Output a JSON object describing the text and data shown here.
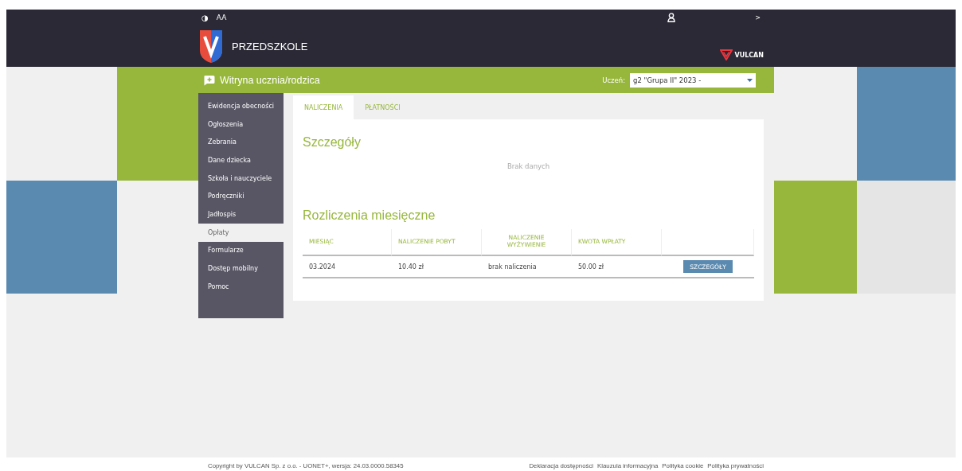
{
  "toolbar": {
    "contrast_label": "◑",
    "font_size_label": "AA",
    "user_arrow": ">"
  },
  "header": {
    "app_name": "PRZEDSZKOLE",
    "brand": "VULCAN"
  },
  "section_bar": {
    "title": "Witryna ucznia/rodzica",
    "student_label": "Uczeń:",
    "student_value": "g2 \"Grupa II\" 2023 -"
  },
  "sidebar": {
    "items": [
      {
        "label": "Ewidencja obecności",
        "selected": false
      },
      {
        "label": "Ogłoszenia",
        "selected": false
      },
      {
        "label": "Zebrania",
        "selected": false
      },
      {
        "label": "Dane dziecka",
        "selected": false
      },
      {
        "label": "Szkoła i nauczyciele",
        "selected": false
      },
      {
        "label": "Podręczniki",
        "selected": false
      },
      {
        "label": "Jadłospis",
        "selected": false
      },
      {
        "label": "Opłaty",
        "selected": true
      },
      {
        "label": "Formularze",
        "selected": false
      },
      {
        "label": "Dostęp mobilny",
        "selected": false
      },
      {
        "label": "Pomoc",
        "selected": false
      }
    ]
  },
  "tabs": [
    {
      "label": "NALICZENIA",
      "selected": true
    },
    {
      "label": "PŁATNOŚCI",
      "selected": false
    }
  ],
  "details": {
    "title": "Szczegóły",
    "empty_text": "Brak danych"
  },
  "monthly": {
    "title": "Rozliczenia miesięczne",
    "columns": [
      "MIESIĄC",
      "NALICZENIE POBYT",
      "NALICZENIE WYŻYWIENIE",
      "KWOTA WPŁATY"
    ],
    "rows": [
      {
        "cells": [
          "03.2024",
          "10.40 zł",
          "brak naliczenia",
          "50.00 zł"
        ],
        "action": "SZCZEGÓŁY"
      }
    ]
  },
  "footer": {
    "copyright": "Copyright by VULCAN Sp. z o.o. - UONET+, wersja: 24.03.0000.58345",
    "links": [
      "Deklaracja dostępności",
      "Klauzula informacyjna",
      "Polityka cookie",
      "Polityka prywatności"
    ]
  }
}
